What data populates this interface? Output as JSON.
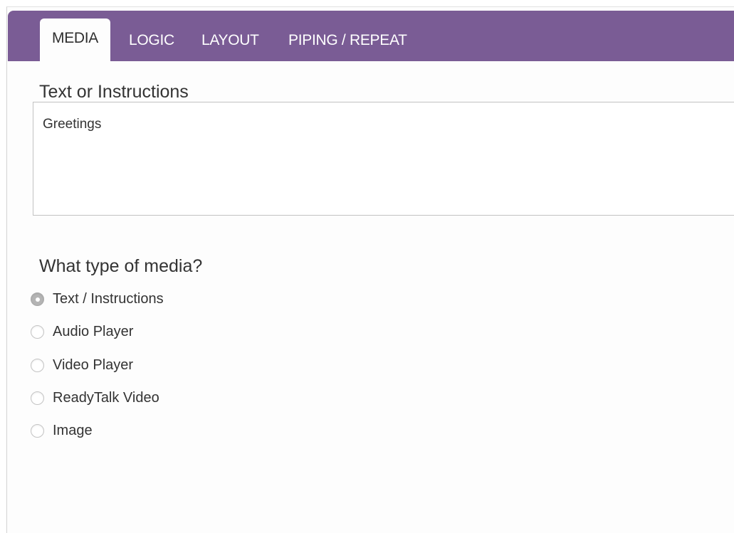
{
  "tabs": [
    {
      "label": "MEDIA",
      "active": true
    },
    {
      "label": "LOGIC",
      "active": false
    },
    {
      "label": "LAYOUT",
      "active": false
    },
    {
      "label": "PIPING / REPEAT",
      "active": false
    }
  ],
  "text_section": {
    "label": "Text or Instructions",
    "value": "Greetings"
  },
  "media_section": {
    "label": "What type of media?",
    "options": [
      {
        "label": "Text / Instructions",
        "selected": true
      },
      {
        "label": "Audio Player",
        "selected": false
      },
      {
        "label": "Video Player",
        "selected": false
      },
      {
        "label": "ReadyTalk Video",
        "selected": false
      },
      {
        "label": "Image",
        "selected": false
      }
    ]
  },
  "colors": {
    "tab_bar": "#7a5c95",
    "tab_text": "#ffffff",
    "background": "#fdfdfd"
  }
}
